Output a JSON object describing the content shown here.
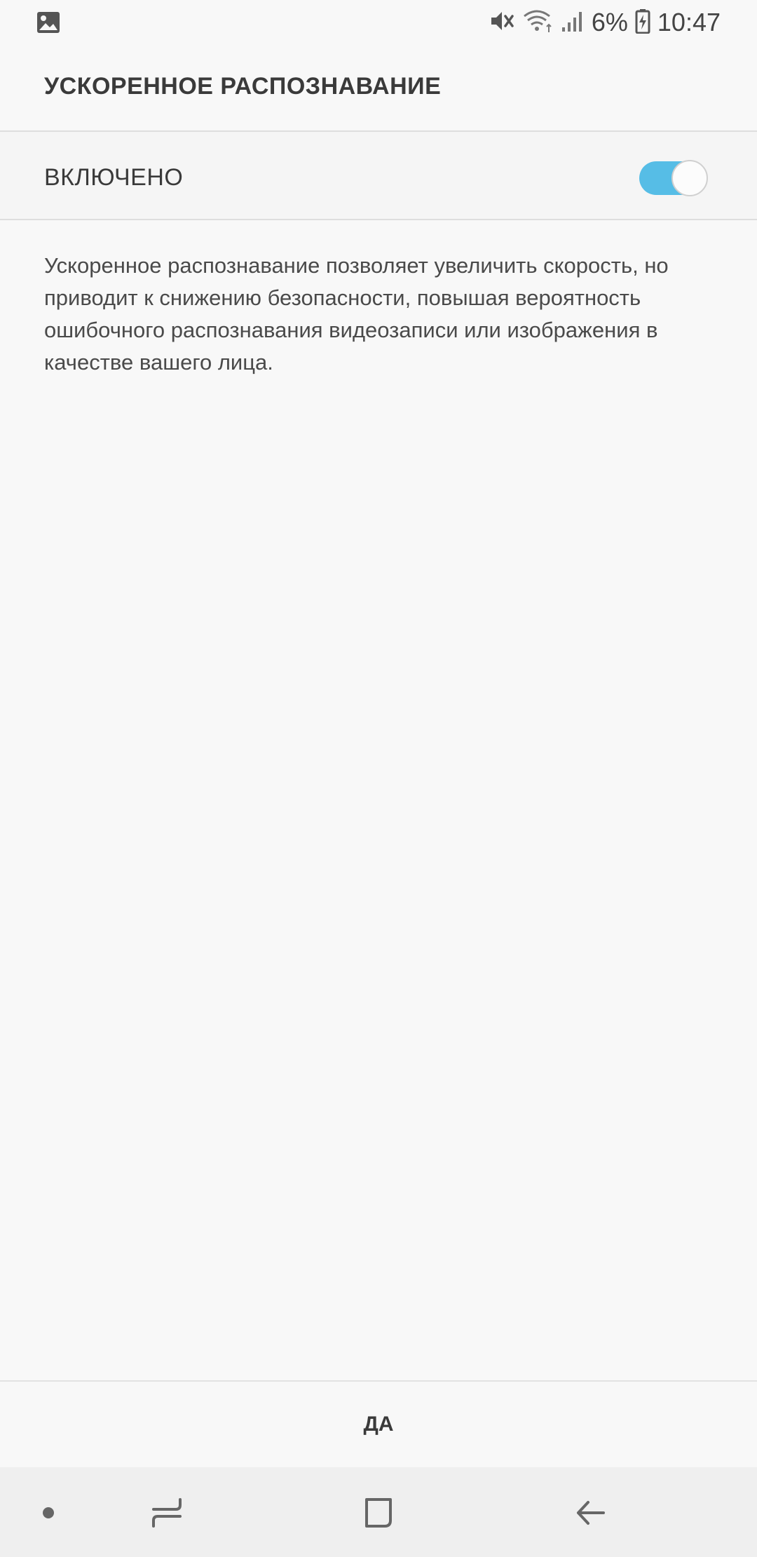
{
  "status_bar": {
    "battery": "6%",
    "time": "10:47",
    "icons": [
      "image-icon",
      "mute-icon",
      "wifi-icon",
      "signal-icon",
      "battery-charging-icon"
    ]
  },
  "page": {
    "title": "УСКОРЕННОЕ РАСПОЗНАВАНИЕ"
  },
  "toggle": {
    "label": "ВКЛЮЧЕНО",
    "state": "on",
    "accent_color": "#56bde6"
  },
  "description": {
    "text": "Ускоренное распознавание позволяет увеличить скорость, но приводит к снижению безопасности, повышая вероятность ошибочного распознавания видеозаписи или изображения в качестве вашего лица."
  },
  "action": {
    "confirm_label": "ДА"
  },
  "nav_bar": {
    "items": [
      "dot-icon",
      "recents-icon",
      "home-icon",
      "back-icon"
    ]
  }
}
